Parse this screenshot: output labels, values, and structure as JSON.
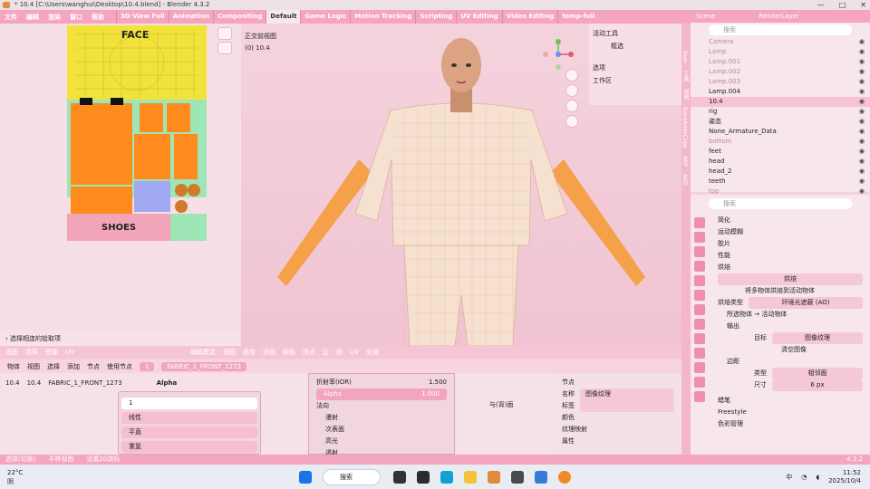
{
  "window": {
    "title": "* 10.4 [C:\\Users\\wanghui\\Desktop\\10.4.blend] - Blender 4.3.2",
    "controls": [
      "—",
      "□",
      "✕"
    ]
  },
  "menubar": {
    "menus": [
      "文件",
      "编辑",
      "渲染",
      "窗口",
      "帮助"
    ],
    "workspaces": [
      "3D View Full",
      "Animation",
      "Compositing",
      "Default",
      "Game Logic",
      "Motion Tracking",
      "Scripting",
      "UV Editing",
      "Video Editing",
      "temp-full"
    ],
    "active_workspace": "Default"
  },
  "scene": {
    "name": "Scene",
    "layer": "RenderLayer"
  },
  "uv_editor": {
    "labels": {
      "face": "FACE",
      "shoes": "SHOES"
    },
    "select_mode": "选择相连的拾取项",
    "header_items": [
      "视图",
      "选择",
      "图像",
      "UV"
    ]
  },
  "viewport": {
    "view_name": "正交前视图",
    "object_info": "(0) 10.4",
    "header_items": [
      "编辑模式",
      "视图",
      "选择",
      "添加",
      "网格",
      "顶点",
      "边",
      "面",
      "UV"
    ],
    "transform": "全局",
    "active_tool_label": "活动工具",
    "active_tool": "框选",
    "options_label": "选项",
    "workspace_label": "工作区"
  },
  "shader_editor": {
    "header": [
      "物体",
      "视图",
      "选择",
      "添加",
      "节点",
      "使用节点"
    ],
    "slot": "1",
    "material": "FABRIC_1_FRONT_1273",
    "breadcrumb": [
      "10.4",
      "10.4",
      "FABRIC_1_FRONT_1273"
    ],
    "output_socket": "Alpha",
    "image_node": {
      "name": "1",
      "interp": "线性",
      "proj": "平直",
      "ext": "重复"
    },
    "bsdf": {
      "ior_label": "折射率(IOR)",
      "ior": "1.500",
      "alpha_label": "Alpha",
      "alpha": "1.000",
      "normal_label": "法向",
      "subs": [
        "漫射",
        "次表面",
        "高光",
        "透射"
      ]
    },
    "normal_out": "与(背)面",
    "node_panel": {
      "title": "节点",
      "name_label": "名称",
      "name_value": "图像纹理",
      "label_label": "标签",
      "color_label": "颜色",
      "mapping_label": "纹理映射",
      "props_label": "属性"
    }
  },
  "outliner": {
    "search_placeholder": "搜索",
    "items": [
      {
        "name": "Camera",
        "on": false
      },
      {
        "name": "Lamp",
        "on": false
      },
      {
        "name": "Lamp.001",
        "on": false
      },
      {
        "name": "Lamp.002",
        "on": false
      },
      {
        "name": "Lamp.003",
        "on": false
      },
      {
        "name": "Lamp.004",
        "on": true
      },
      {
        "name": "10.4",
        "on": true,
        "selected": true
      },
      {
        "name": "rig",
        "on": true
      },
      {
        "name": "姿态",
        "on": true
      },
      {
        "name": "None_Armature_Data",
        "on": true
      },
      {
        "name": "bottom",
        "on": false
      },
      {
        "name": "feet",
        "on": true
      },
      {
        "name": "head",
        "on": true
      },
      {
        "name": "head_2",
        "on": true
      },
      {
        "name": "teeth",
        "on": true
      },
      {
        "name": "top",
        "on": false
      }
    ]
  },
  "properties": {
    "search_placeholder": "搜索",
    "sections": [
      "简化",
      "运动模糊",
      "胶片",
      "性能",
      "烘焙"
    ],
    "bake_button": "烘焙",
    "selected_to_active": "将多物体烘焙到活动物体",
    "bake_type_label": "烘焙类型",
    "bake_type": "环境光遮蔽 (AO)",
    "selected_active_panel": "所选物体 → 活动物体",
    "output_label": "输出",
    "target_label": "目标",
    "target": "图像纹理",
    "clear_image": "清空图像",
    "margin_label": "边距",
    "margin_type_label": "类型",
    "margin_type": "相邻面",
    "margin_size_label": "尺寸",
    "margin_size": "6 px",
    "more": [
      "蜡笔",
      "Freestyle",
      "色彩管理"
    ]
  },
  "sidebar_tabs": [
    "Item",
    "工具",
    "视图",
    "BoneAnimCopy",
    "ARP",
    "AKD"
  ],
  "status": {
    "items": [
      "选择(切换)",
      "平移视图",
      "设置20游标"
    ],
    "version": "4.3.2"
  },
  "taskbar": {
    "weather_temp": "22°C",
    "weather_desc": "阴",
    "search": "搜索",
    "lang": "中",
    "time": "11:52",
    "date": "2025/10/4"
  },
  "colors": {
    "accent": "#f5a5bd",
    "uv_yellow": "#f2e33b",
    "uv_orange": "#ff8a1e",
    "uv_green": "#9fe6b6",
    "skin_orange": "#f5a14a"
  }
}
